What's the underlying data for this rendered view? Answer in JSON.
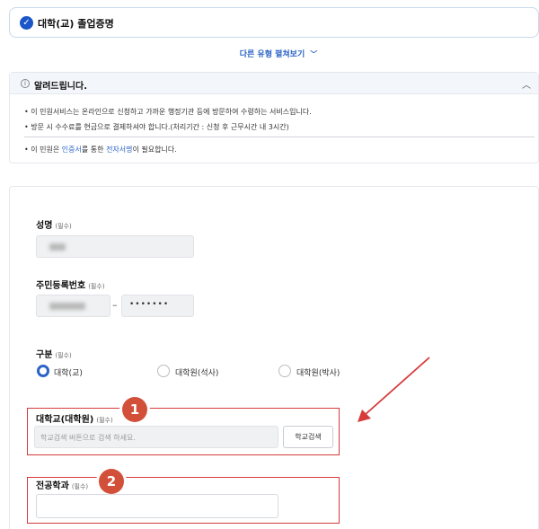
{
  "service": {
    "title": "대학(교) 졸업증명"
  },
  "other_types": {
    "label": "다른 유형 펼쳐보기"
  },
  "notice": {
    "title": "알려드립니다.",
    "lines": [
      "이 민원서비스는 온라인으로 신청하고 가까운 행정기관 등에 방문하여 수령하는 서비스입니다.",
      "방문 시 수수료를 현금으로 결제하셔야 합니다.(처리기간 : 신청 후 근무시간 내 3시간)"
    ],
    "cert_prefix": "이 민원은 ",
    "cert_link1": "인증서",
    "cert_mid": "를 통한 ",
    "cert_link2": "전자서명",
    "cert_suffix": "이 필요합니다."
  },
  "form": {
    "required_tag": "(필수)",
    "name_label": "성명",
    "rrn_label": "주민등록번호",
    "rrn_dash": "–",
    "rrn_back_value": "•••••••",
    "category_label": "구분",
    "category_options": [
      "대학(교)",
      "대학원(석사)",
      "대학원(박사)"
    ],
    "category_selected": "대학(교)",
    "school_label": "대학교(대학원)",
    "school_placeholder": "학교검색 버튼으로 검색 하세요.",
    "school_search_button": "학교검색",
    "major_label": "전공학과"
  },
  "annotations": {
    "badge1": "1",
    "badge2": "2"
  },
  "colors": {
    "accent": "#2b63c7",
    "annotation_red": "#d63a3a",
    "badge": "#d2503a"
  }
}
